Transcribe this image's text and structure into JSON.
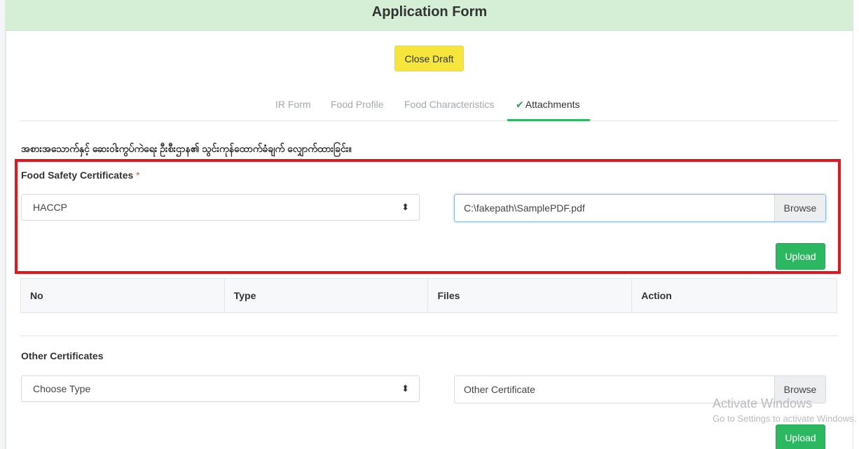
{
  "header": {
    "title": "Application Form"
  },
  "close_draft_label": "Close Draft",
  "tabs": [
    {
      "label": "IR Form",
      "active": false
    },
    {
      "label": "Food Profile",
      "active": false
    },
    {
      "label": "Food Characteristics",
      "active": false
    },
    {
      "label": "Attachments",
      "active": true,
      "icon": "check-icon"
    }
  ],
  "notice_text": "အစားအသောက်နှင့် ဆေးဝါးကွပ်ကဲရေး ဦးစီးဌာန၏ သွင်းကုန်ထောက်ခံချက် လျှောက်ထားခြင်း။",
  "food_safety": {
    "label": "Food Safety Certificates",
    "required_mark": "*",
    "type_selected": "HACCP",
    "file_value": "C:\\fakepath\\SamplePDF.pdf",
    "browse_label": "Browse",
    "upload_label": "Upload"
  },
  "table": {
    "headers": [
      "No",
      "Type",
      "Files",
      "Action"
    ]
  },
  "other_certs": {
    "label": "Other Certificates",
    "type_selected": "Choose Type",
    "file_placeholder": "Other Certificate",
    "browse_label": "Browse",
    "upload_label": "Upload"
  },
  "watermark": {
    "line1": "Activate Windows",
    "line2": "Go to Settings to activate Windows."
  },
  "colors": {
    "header_bg": "#d4efd5",
    "close_draft_bg": "#f6e63c",
    "upload_bg": "#2bb861",
    "highlight_border": "#e3151d",
    "active_tab_underline": "#2fb864"
  }
}
